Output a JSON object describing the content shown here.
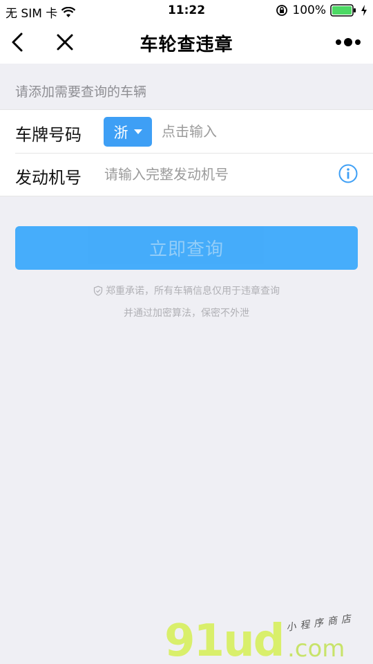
{
  "status_bar": {
    "carrier": "无 SIM 卡",
    "time": "11:22",
    "battery": "100%"
  },
  "nav": {
    "title": "车轮查违章",
    "back_icon": "chevron-left-icon",
    "close_icon": "close-icon",
    "more_icon": "more-dots-icon"
  },
  "form": {
    "section_hint": "请添加需要查询的车辆",
    "plate": {
      "label": "车牌号码",
      "province": "浙",
      "placeholder": "点击输入",
      "value": ""
    },
    "engine": {
      "label": "发动机号",
      "placeholder": "请输入完整发动机号",
      "value": ""
    }
  },
  "actions": {
    "query_label": "立即查询"
  },
  "notice": {
    "line1": "郑重承诺，所有车辆信息仅用于违章查询",
    "line2": "并通过加密算法，保密不外泄"
  },
  "watermark": {
    "main": "91ud",
    "com": ".com",
    "sub": "小程序商店"
  },
  "colors": {
    "accent": "#3e9ff5",
    "button": "#3ca9fb",
    "background": "#efeff4"
  }
}
